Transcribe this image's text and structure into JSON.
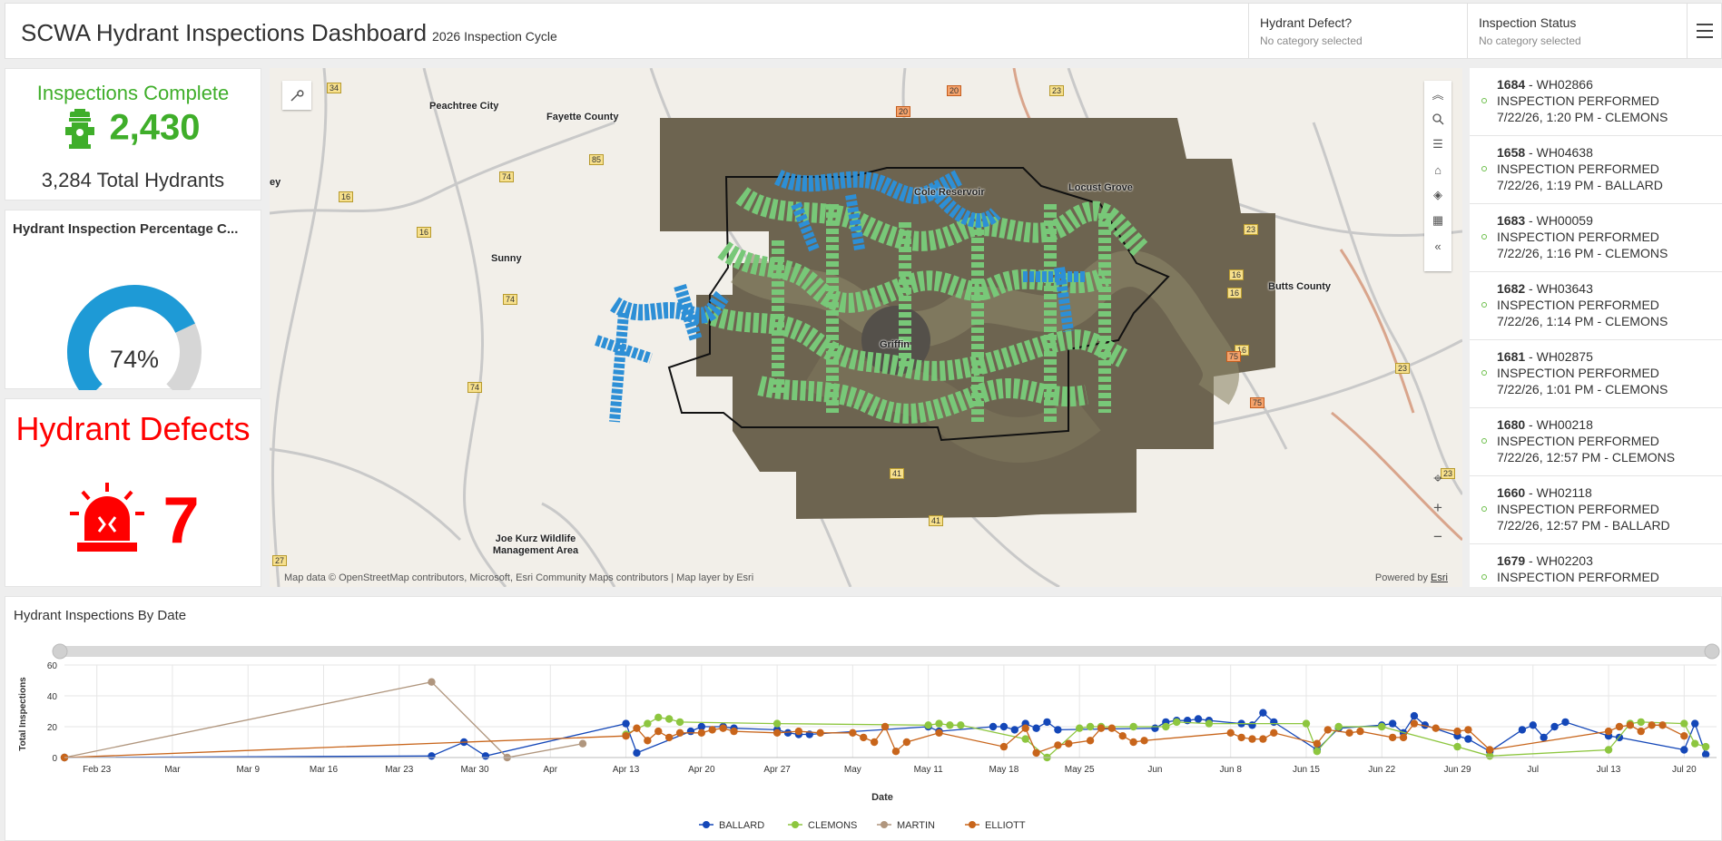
{
  "header": {
    "title": "SCWA Hydrant Inspections Dashboard",
    "subtitle": "2026 Inspection Cycle",
    "filters": [
      {
        "label": "Hydrant Defect?",
        "value": "No category selected"
      },
      {
        "label": "Inspection Status",
        "value": "No category selected"
      }
    ]
  },
  "inspections_card": {
    "title": "Inspections Complete",
    "value": "2,430",
    "subtext": "3,284 Total Hydrants",
    "color": "#3fae2a",
    "icon": "fire-hydrant-icon"
  },
  "gauge": {
    "title": "Hydrant Inspection Percentage C...",
    "value_label": "74%",
    "percent": 74,
    "fill_color": "#1e9ad6",
    "track_color": "#d6d6d6"
  },
  "defects_card": {
    "title": "Hydrant Defects",
    "value": "7",
    "color": "#ff0000",
    "icon": "alarm-siren-icon"
  },
  "map": {
    "labels": [
      "Peachtree City",
      "Fayette County",
      "Cole Reservoir",
      "Locust Grove",
      "Butts County",
      "Griffin",
      "Sunny",
      "Joe Kurz Wildlife Management Area",
      "ey"
    ],
    "shields": [
      "34",
      "20",
      "23",
      "20",
      "85",
      "74",
      "16",
      "16",
      "74",
      "16",
      "23",
      "16",
      "16",
      "75",
      "75",
      "23",
      "74",
      "41",
      "41",
      "27",
      "23"
    ],
    "attribution": "Map data © OpenStreetMap contributors, Microsoft, Esri Community Maps contributors | Map layer by Esri",
    "powered_prefix": "Powered by ",
    "powered_link": "Esri",
    "tools": [
      "collapse-up-icon",
      "search-icon",
      "legend-icon",
      "home-icon",
      "layers-icon",
      "qr-icon",
      "collapse-left-icon"
    ]
  },
  "inspection_list": [
    {
      "id": "1684",
      "hydrant": "WH02866",
      "status": "INSPECTION PERFORMED",
      "detail": "7/22/26, 1:20 PM - CLEMONS"
    },
    {
      "id": "1658",
      "hydrant": "WH04638",
      "status": "INSPECTION PERFORMED",
      "detail": "7/22/26, 1:19 PM - BALLARD"
    },
    {
      "id": "1683",
      "hydrant": "WH00059",
      "status": "INSPECTION PERFORMED",
      "detail": "7/22/26, 1:16 PM - CLEMONS"
    },
    {
      "id": "1682",
      "hydrant": "WH03643",
      "status": "INSPECTION PERFORMED",
      "detail": "7/22/26, 1:14 PM - CLEMONS"
    },
    {
      "id": "1681",
      "hydrant": "WH02875",
      "status": "INSPECTION PERFORMED",
      "detail": "7/22/26, 1:01 PM - CLEMONS"
    },
    {
      "id": "1680",
      "hydrant": "WH00218",
      "status": "INSPECTION PERFORMED",
      "detail": "7/22/26, 12:57 PM - CLEMONS"
    },
    {
      "id": "1660",
      "hydrant": "WH02118",
      "status": "INSPECTION PERFORMED",
      "detail": "7/22/26, 12:57 PM - BALLARD"
    },
    {
      "id": "1679",
      "hydrant": "WH02203",
      "status": "INSPECTION PERFORMED",
      "detail": ""
    }
  ],
  "chart_data": {
    "type": "line",
    "title": "Hydrant Inspections By Date",
    "xlabel": "Date",
    "ylabel": "Total Inspections",
    "ylim": [
      0,
      60
    ],
    "yticks": [
      0,
      20,
      40,
      60
    ],
    "xlim": [
      "2026-02-20",
      "2026-07-23"
    ],
    "xticks": [
      {
        "date": "2026-02-23",
        "label": "Feb 23"
      },
      {
        "date": "2026-03-02",
        "label": "Mar"
      },
      {
        "date": "2026-03-09",
        "label": "Mar 9"
      },
      {
        "date": "2026-03-16",
        "label": "Mar 16"
      },
      {
        "date": "2026-03-23",
        "label": "Mar 23"
      },
      {
        "date": "2026-03-30",
        "label": "Mar 30"
      },
      {
        "date": "2026-04-06",
        "label": "Apr"
      },
      {
        "date": "2026-04-13",
        "label": "Apr 13"
      },
      {
        "date": "2026-04-20",
        "label": "Apr 20"
      },
      {
        "date": "2026-04-27",
        "label": "Apr 27"
      },
      {
        "date": "2026-05-04",
        "label": "May"
      },
      {
        "date": "2026-05-11",
        "label": "May 11"
      },
      {
        "date": "2026-05-18",
        "label": "May 18"
      },
      {
        "date": "2026-05-25",
        "label": "May 25"
      },
      {
        "date": "2026-06-01",
        "label": "Jun"
      },
      {
        "date": "2026-06-08",
        "label": "Jun 8"
      },
      {
        "date": "2026-06-15",
        "label": "Jun 15"
      },
      {
        "date": "2026-06-22",
        "label": "Jun 22"
      },
      {
        "date": "2026-06-29",
        "label": "Jun 29"
      },
      {
        "date": "2026-07-06",
        "label": "Jul"
      },
      {
        "date": "2026-07-13",
        "label": "Jul 13"
      },
      {
        "date": "2026-07-20",
        "label": "Jul 20"
      }
    ],
    "legend_position": "bottom",
    "grid": true,
    "series": [
      {
        "name": "BALLARD",
        "color": "#1447b8",
        "points": [
          [
            "2026-02-20",
            0
          ],
          [
            "2026-03-26",
            1
          ],
          [
            "2026-03-29",
            10
          ],
          [
            "2026-03-31",
            1
          ],
          [
            "2026-04-13",
            22
          ],
          [
            "2026-04-14",
            3
          ],
          [
            "2026-04-19",
            17
          ],
          [
            "2026-04-20",
            20
          ],
          [
            "2026-04-22",
            20
          ],
          [
            "2026-04-23",
            19
          ],
          [
            "2026-04-27",
            18
          ],
          [
            "2026-04-28",
            16
          ],
          [
            "2026-04-29",
            15
          ],
          [
            "2026-04-30",
            15
          ],
          [
            "2026-05-11",
            20
          ],
          [
            "2026-05-12",
            17
          ],
          [
            "2026-05-17",
            20
          ],
          [
            "2026-05-18",
            20
          ],
          [
            "2026-05-19",
            18
          ],
          [
            "2026-05-20",
            22
          ],
          [
            "2026-05-21",
            19
          ],
          [
            "2026-05-22",
            23
          ],
          [
            "2026-05-23",
            18
          ],
          [
            "2026-06-01",
            19
          ],
          [
            "2026-06-02",
            23
          ],
          [
            "2026-06-03",
            24
          ],
          [
            "2026-06-04",
            24
          ],
          [
            "2026-06-05",
            25
          ],
          [
            "2026-06-06",
            24
          ],
          [
            "2026-06-09",
            22
          ],
          [
            "2026-06-10",
            21
          ],
          [
            "2026-06-11",
            29
          ],
          [
            "2026-06-12",
            23
          ],
          [
            "2026-06-16",
            5
          ],
          [
            "2026-06-18",
            19
          ],
          [
            "2026-06-22",
            21
          ],
          [
            "2026-06-23",
            22
          ],
          [
            "2026-06-24",
            16
          ],
          [
            "2026-06-25",
            27
          ],
          [
            "2026-06-26",
            21
          ],
          [
            "2026-06-29",
            14
          ],
          [
            "2026-06-30",
            12
          ],
          [
            "2026-07-02",
            4
          ],
          [
            "2026-07-05",
            18
          ],
          [
            "2026-07-06",
            21
          ],
          [
            "2026-07-07",
            13
          ],
          [
            "2026-07-08",
            20
          ],
          [
            "2026-07-09",
            23
          ],
          [
            "2026-07-13",
            14
          ],
          [
            "2026-07-14",
            13
          ],
          [
            "2026-07-20",
            5
          ],
          [
            "2026-07-21",
            22
          ],
          [
            "2026-07-22",
            2
          ]
        ]
      },
      {
        "name": "CLEMONS",
        "color": "#8dc63f",
        "points": [
          [
            "2026-04-13",
            15
          ],
          [
            "2026-04-15",
            22
          ],
          [
            "2026-04-16",
            26
          ],
          [
            "2026-04-17",
            25
          ],
          [
            "2026-04-18",
            23
          ],
          [
            "2026-04-27",
            22
          ],
          [
            "2026-05-11",
            21
          ],
          [
            "2026-05-12",
            22
          ],
          [
            "2026-05-13",
            21
          ],
          [
            "2026-05-14",
            21
          ],
          [
            "2026-05-20",
            12
          ],
          [
            "2026-05-22",
            0
          ],
          [
            "2026-05-25",
            19
          ],
          [
            "2026-05-26",
            20
          ],
          [
            "2026-05-27",
            20
          ],
          [
            "2026-05-30",
            20
          ],
          [
            "2026-06-02",
            20
          ],
          [
            "2026-06-03",
            23
          ],
          [
            "2026-06-06",
            22
          ],
          [
            "2026-06-15",
            22
          ],
          [
            "2026-06-16",
            4
          ],
          [
            "2026-06-18",
            20
          ],
          [
            "2026-06-22",
            20
          ],
          [
            "2026-06-29",
            7
          ],
          [
            "2026-07-02",
            1
          ],
          [
            "2026-07-13",
            5
          ],
          [
            "2026-07-15",
            22
          ],
          [
            "2026-07-16",
            23
          ],
          [
            "2026-07-20",
            22
          ],
          [
            "2026-07-21",
            9
          ],
          [
            "2026-07-22",
            7
          ]
        ]
      },
      {
        "name": "MARTIN",
        "color": "#b0967e",
        "points": [
          [
            "2026-02-20",
            0
          ],
          [
            "2026-03-26",
            49
          ],
          [
            "2026-04-02",
            0
          ],
          [
            "2026-04-09",
            9
          ]
        ]
      },
      {
        "name": "ELLIOTT",
        "color": "#c8651b",
        "points": [
          [
            "2026-02-20",
            0
          ],
          [
            "2026-04-13",
            14
          ],
          [
            "2026-04-14",
            19
          ],
          [
            "2026-04-15",
            11
          ],
          [
            "2026-04-16",
            17
          ],
          [
            "2026-04-17",
            13
          ],
          [
            "2026-04-18",
            16
          ],
          [
            "2026-04-20",
            16
          ],
          [
            "2026-04-21",
            18
          ],
          [
            "2026-04-22",
            19
          ],
          [
            "2026-04-23",
            17
          ],
          [
            "2026-04-27",
            16
          ],
          [
            "2026-04-29",
            17
          ],
          [
            "2026-05-01",
            16
          ],
          [
            "2026-05-04",
            16
          ],
          [
            "2026-05-05",
            13
          ],
          [
            "2026-05-06",
            10
          ],
          [
            "2026-05-07",
            20
          ],
          [
            "2026-05-08",
            4
          ],
          [
            "2026-05-09",
            10
          ],
          [
            "2026-05-12",
            16
          ],
          [
            "2026-05-18",
            7
          ],
          [
            "2026-05-20",
            19
          ],
          [
            "2026-05-21",
            3
          ],
          [
            "2026-05-23",
            8
          ],
          [
            "2026-05-24",
            9
          ],
          [
            "2026-05-26",
            11
          ],
          [
            "2026-05-27",
            19
          ],
          [
            "2026-05-28",
            19
          ],
          [
            "2026-05-29",
            14
          ],
          [
            "2026-05-30",
            10
          ],
          [
            "2026-05-31",
            11
          ],
          [
            "2026-06-08",
            16
          ],
          [
            "2026-06-09",
            13
          ],
          [
            "2026-06-10",
            12
          ],
          [
            "2026-06-11",
            12
          ],
          [
            "2026-06-12",
            16
          ],
          [
            "2026-06-16",
            9
          ],
          [
            "2026-06-17",
            18
          ],
          [
            "2026-06-19",
            16
          ],
          [
            "2026-06-20",
            17
          ],
          [
            "2026-06-23",
            13
          ],
          [
            "2026-06-24",
            13
          ],
          [
            "2026-06-25",
            22
          ],
          [
            "2026-06-27",
            19
          ],
          [
            "2026-06-29",
            17
          ],
          [
            "2026-06-30",
            18
          ],
          [
            "2026-07-02",
            5
          ],
          [
            "2026-07-13",
            17
          ],
          [
            "2026-07-14",
            20
          ],
          [
            "2026-07-15",
            21
          ],
          [
            "2026-07-16",
            17
          ],
          [
            "2026-07-17",
            21
          ],
          [
            "2026-07-18",
            21
          ],
          [
            "2026-07-20",
            14
          ]
        ]
      }
    ]
  }
}
